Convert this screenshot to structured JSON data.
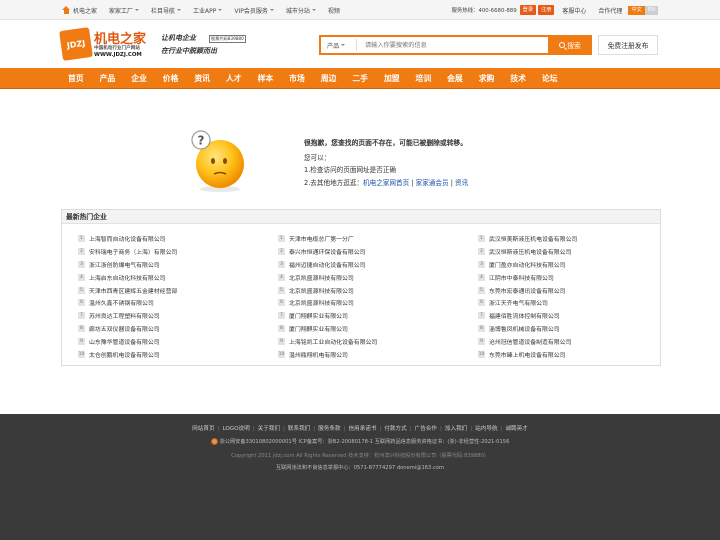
{
  "topbar": {
    "home": "机电之家",
    "items": [
      "家家工厂",
      "栏目导航",
      "工业APP",
      "VIP会员服务",
      "城市分站",
      "视频"
    ],
    "hotline": "服务热线：400-6680-889",
    "login": "登录",
    "register": "注册",
    "links": [
      "客服中心",
      "合作代理"
    ],
    "lang_cn": "中文",
    "lang_en": "EN"
  },
  "header": {
    "logo_mark": "JDZJ",
    "logo_name": "机电之家",
    "logo_sub": "中国机电行业门户网站",
    "logo_url": "WWW.JDZJ.COM",
    "slogan_1": "让机电企业",
    "slogan_2": "在行业中脱颖而出",
    "stock": "股票代码839880",
    "search_category": "产品",
    "search_placeholder": "请输入你要搜索的信息",
    "search_button": "搜索",
    "free_register": "免费注册发布"
  },
  "nav": [
    "首页",
    "产品",
    "企业",
    "价格",
    "资讯",
    "人才",
    "样本",
    "市场",
    "周边",
    "二手",
    "加盟",
    "培训",
    "会展",
    "求购",
    "技术",
    "论坛"
  ],
  "error": {
    "title": "很抱歉，您查找的页面不存在，可能已被删除或转移。",
    "maybe": "您可以：",
    "tip1": "1.检查访问的页面网址是否正确",
    "tip2_prefix": "2.去其他地方逛逛：",
    "link1": "机电之家网首页",
    "sep": " | ",
    "link2": "家家通会员",
    "link3": "资讯"
  },
  "hot": {
    "title": "最新热门企业",
    "col1": [
      "上海智而自动化设备有限公司",
      "安科瑞电子商务（上海）有限公司",
      "浙江浙创防爆电气有限公司",
      "上海启东自动化科技有限公司",
      "天津市西青区建辉五金建材经营部",
      "温州久鑫不锈钢有限公司",
      "苏州良达工程塑料有限公司",
      "廊坊五双仪器设备有限公司",
      "山东豫华管道设备有限公司",
      "太仓创鹏机电设备有限公司"
    ],
    "col2": [
      "天津市电缆总厂第一分厂",
      "泰兴市恒通环保设备有限公司",
      "福州迈捷自动化设备有限公司",
      "北京凯盛源科技有限公司",
      "北京凯盛源科技有限公司",
      "北京凯盛源科技有限公司",
      "厦门翔麒实业有限公司",
      "厦门翔麒实业有限公司",
      "上海铭凯工业自动化设备有限公司",
      "温州鼎翔机电有限公司"
    ],
    "col3": [
      "武汉恒美斯液压机电设备有限公司",
      "武汉恒斯液压机电设备有限公司",
      "厦门盈亦自动化科技有限公司",
      "江阴市中泰科技有限公司",
      "东莞市宏泰通讯设备有限公司",
      "浙江天齐电气有限公司",
      "福建佰胜流体控制有限公司",
      "淄博鲁凤机械设备有限公司",
      "沧州冠信管道设备制造有限公司",
      "东莞市臻上机电设备有限公司"
    ]
  },
  "footer": {
    "links": [
      "网站首页",
      "LOGO说明",
      "关于我们",
      "联系我们",
      "服务条款",
      "信用承诺书",
      "付款方式",
      "广告合作",
      "加入我们",
      "站内导航",
      "诚聘英才"
    ],
    "line1": "浙公网安备33010802000001号 ICP备案号：浙B2-20080178-1 互联网药品信息服务资格证书：(浙)-非经营性-2021-0156",
    "line2": "Copyright 2011 jdzj.com All Rights Reserved 技术支持：杭州滨兴科技股份有限公司（股票代码:839880）",
    "line3": "互联网违法和不良信息举报中心：0571-87774297 donemi@163.com"
  }
}
